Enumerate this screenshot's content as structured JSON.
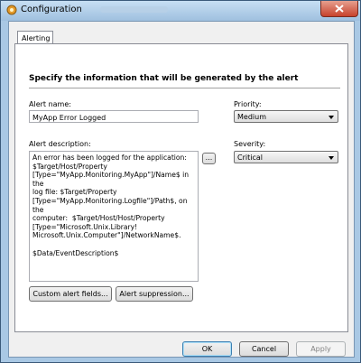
{
  "window": {
    "title": "Configuration"
  },
  "tabs": [
    {
      "label": "Alerting"
    }
  ],
  "section": {
    "heading": "Specify the information that will be generated by the alert"
  },
  "alert_name": {
    "label": "Alert name:",
    "value": "MyApp Error Logged"
  },
  "priority": {
    "label": "Priority:",
    "value": "Medium"
  },
  "alert_description": {
    "label": "Alert description:",
    "value": "An error has been logged for the application:\n$Target/Host/Property\n[Type=\"MyApp.Monitoring.MyApp\"]/Name$ in the\nlog file: $Target/Property\n[Type=\"MyApp.Monitoring.Logfile\"]/Path$, on the\ncomputer:  $Target/Host/Host/Property\n[Type=\"Microsoft.Unix.Library!\nMicrosoft.Unix.Computer\"]/NetworkName$.\n\n$Data/EventDescription$",
    "browse_label": "..."
  },
  "severity": {
    "label": "Severity:",
    "value": "Critical"
  },
  "buttons": {
    "custom_fields": "Custom alert fields...",
    "suppression": "Alert suppression...",
    "ok": "OK",
    "cancel": "Cancel",
    "apply": "Apply"
  }
}
